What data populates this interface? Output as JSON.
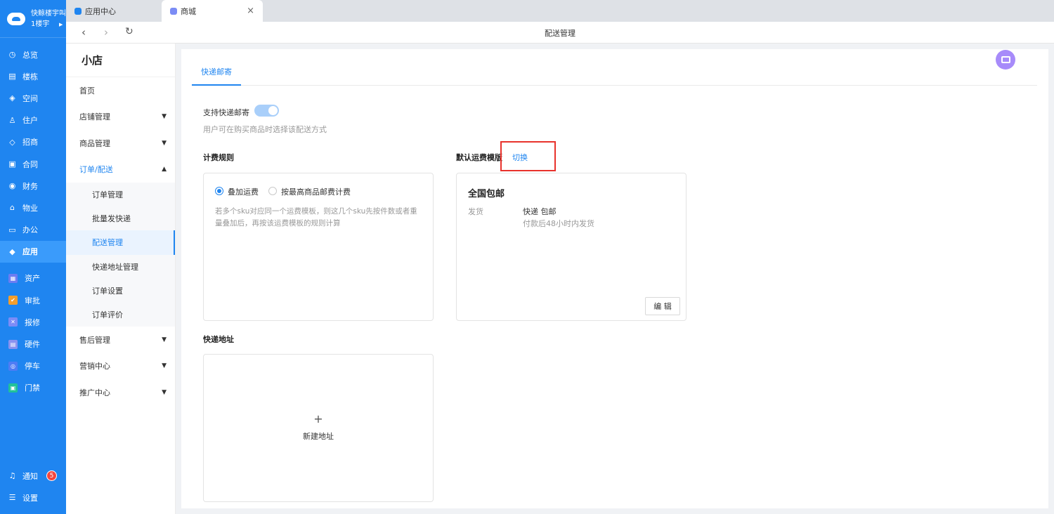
{
  "brand": {
    "name": "快鲸楼宇叫",
    "building": "1楼宇"
  },
  "rail": {
    "items": [
      {
        "label": "总览",
        "icon": "clock-icon",
        "glyph": "◷"
      },
      {
        "label": "楼栋",
        "icon": "building-icon",
        "glyph": "▤"
      },
      {
        "label": "空间",
        "icon": "cube-icon",
        "glyph": "◈"
      },
      {
        "label": "住户",
        "icon": "users-icon",
        "glyph": "♙"
      },
      {
        "label": "招商",
        "icon": "tag-icon",
        "glyph": "◇"
      },
      {
        "label": "合同",
        "icon": "document-icon",
        "glyph": "▣"
      },
      {
        "label": "财务",
        "icon": "coin-icon",
        "glyph": "◉"
      },
      {
        "label": "物业",
        "icon": "home-icon",
        "glyph": "⌂"
      },
      {
        "label": "办公",
        "icon": "monitor-icon",
        "glyph": "▭"
      },
      {
        "label": "应用",
        "icon": "app-cube-icon",
        "glyph": "◆"
      }
    ],
    "apps": [
      {
        "label": "资产",
        "icon": "asset-icon",
        "color": "#6c7cf2"
      },
      {
        "label": "审批",
        "icon": "approval-icon",
        "color": "#f59e2b"
      },
      {
        "label": "报修",
        "icon": "repair-icon",
        "color": "#7c8cf7"
      },
      {
        "label": "硬件",
        "icon": "hardware-icon",
        "color": "#8b93f0"
      },
      {
        "label": "停车",
        "icon": "parking-icon",
        "color": "#4f7cf5"
      },
      {
        "label": "门禁",
        "icon": "door-icon",
        "color": "#21c19a"
      }
    ],
    "notify": {
      "label": "通知",
      "count": "5"
    },
    "settings": {
      "label": "设置"
    }
  },
  "tabs": [
    {
      "label": "应用中心",
      "color": "#1f85f0"
    },
    {
      "label": "商城",
      "color": "#7b8cf5",
      "close": "×"
    }
  ],
  "nav": {
    "title": "配送管理"
  },
  "side": {
    "shop": "小店",
    "home": "首页",
    "store": "店铺管理",
    "goods": "商品管理",
    "order": "订单/配送",
    "subs": [
      "订单管理",
      "批量发快递",
      "配送管理",
      "快递地址管理",
      "订单设置",
      "订单评价"
    ],
    "after": "售后管理",
    "marketing": "营销中心",
    "promo": "推广中心"
  },
  "main": {
    "tab": "快递邮寄",
    "support_label": "支持快递邮寄",
    "support_hint": "用户可在购买商品时选择该配送方式",
    "billing_title": "计费规则",
    "radio1": "叠加运费",
    "radio2": "按最高商品邮费计费",
    "billing_desc1": "若多个sku对应同一个运费模板，则这几个sku先按件数或者重",
    "billing_desc2": "量叠加后，再按该运费模板的规则计算",
    "default_title": "默认运费模版",
    "switch_link": "切换",
    "template_name": "全国包邮",
    "ship_label": "发货",
    "ship_value": "快递 包邮",
    "ship_time": "付款后48小时内发货",
    "edit": "编 辑",
    "address_title": "快递地址",
    "plus": "+",
    "new_address": "新建地址"
  }
}
